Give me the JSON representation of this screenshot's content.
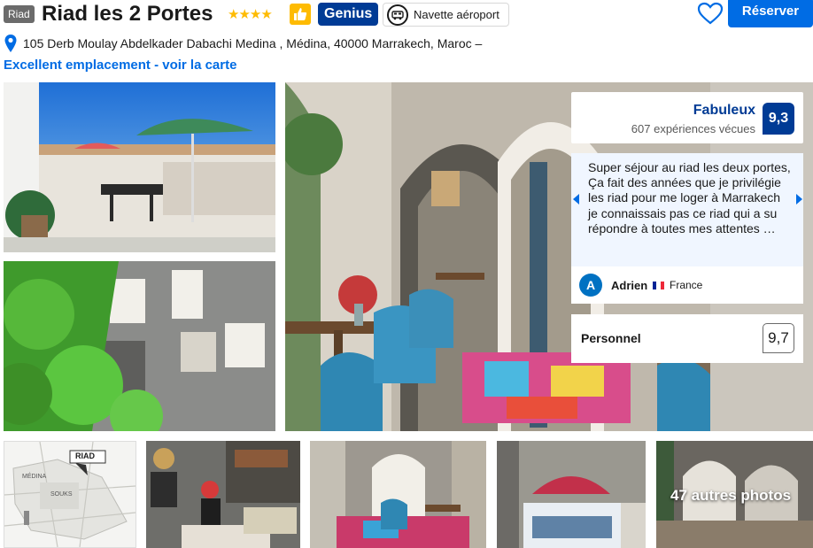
{
  "header": {
    "type_badge": "Riad",
    "hotel_name": "Riad les 2 Portes",
    "stars": "★★★★",
    "genius_label": "Genius",
    "shuttle_label": "Navette aéroport",
    "reserve_label": "Réserver"
  },
  "address": {
    "text": "105 Derb Moulay Abdelkader Dabachi Medina , Médina, 40000 Marrakech, Maroc –",
    "location_link": "Excellent emplacement - voir la carte"
  },
  "review": {
    "score_word": "Fabuleux",
    "score_count": "607 expériences vécues",
    "score": "9,3",
    "text": "Super séjour au riad les deux portes, Ça fait des années que je privilégie les riad pour me loger à Marrakech je connaissais pas ce riad qui a su répondre à toutes mes attentes …",
    "author_initial": "A",
    "author_name": "Adrien",
    "author_country": "France",
    "category_label": "Personnel",
    "category_score": "9,7"
  },
  "gallery": {
    "more_photos": "47 autres photos",
    "map_labels": [
      "RIAD",
      "SOUKS",
      "MÉDINA"
    ]
  },
  "colors": {
    "brand_blue": "#003b95",
    "action_blue": "#006ce4",
    "star_yellow": "#febb02"
  },
  "icons": [
    "map-pin-icon",
    "thumbs-up-icon",
    "shuttle-icon",
    "heart-icon",
    "chevron-left-icon",
    "chevron-right-icon"
  ]
}
